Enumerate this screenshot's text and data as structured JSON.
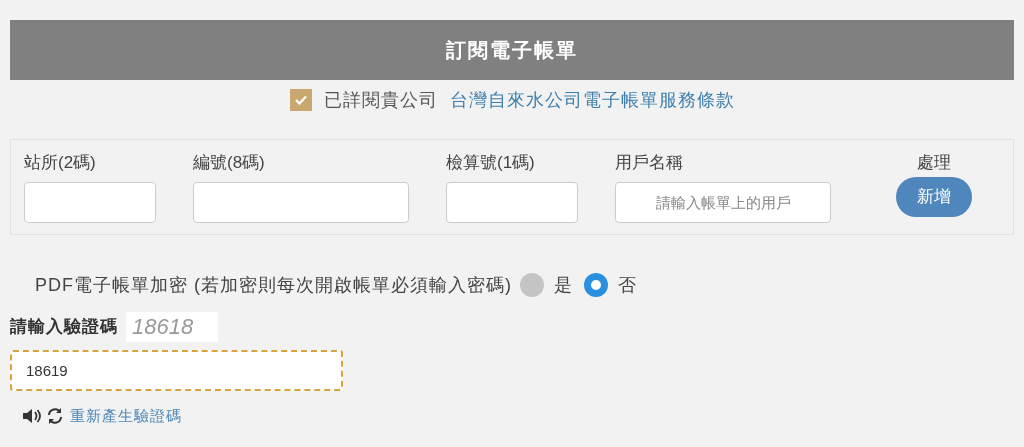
{
  "title": "訂閱電子帳單",
  "agreement": {
    "checked": true,
    "text": "已詳閱貴公司",
    "link": "台灣自來水公司電子帳單服務條款"
  },
  "fields": [
    {
      "label": "站所(2碼)",
      "kind": "short"
    },
    {
      "label": "編號(8碼)",
      "kind": "long"
    },
    {
      "label": "檢算號(1碼)",
      "kind": "short"
    },
    {
      "label": "用戶名稱",
      "kind": "long",
      "placeholder": "請輸入帳單上的用戶"
    }
  ],
  "action": {
    "label": "處理",
    "button": "新增"
  },
  "encryption": {
    "label": "PDF電子帳單加密 (若加密則每次開啟帳單必須輸入密碼)",
    "options": [
      {
        "label": "是",
        "selected": false
      },
      {
        "label": "否",
        "selected": true
      }
    ]
  },
  "captcha": {
    "label": "請輸入驗證碼",
    "code": "18618",
    "value": "18619",
    "focused": true,
    "regenerate": "重新產生驗證碼"
  }
}
